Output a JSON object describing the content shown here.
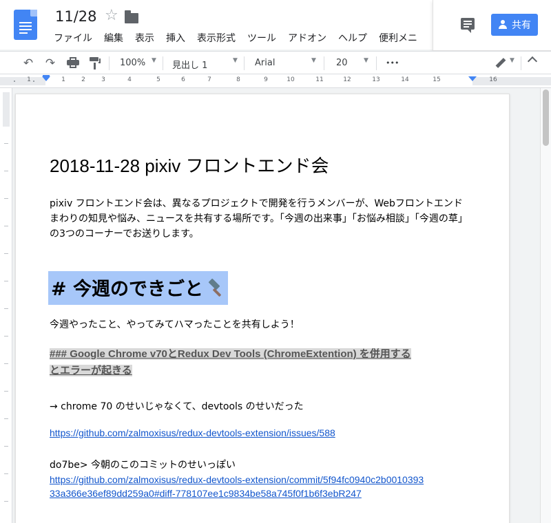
{
  "header": {
    "doc_title": "11/28",
    "menus": [
      "ファイル",
      "編集",
      "表示",
      "挿入",
      "表示形式",
      "ツール",
      "アドオン",
      "ヘルプ",
      "便利メニ"
    ],
    "share_label": "共有",
    "brand_color": "#4285f4"
  },
  "toolbar": {
    "zoom": "100%",
    "style": "見出し 1",
    "font": "Arial",
    "size": "20",
    "more": "•••",
    "undo_icon": "↶",
    "redo_icon": "↷"
  },
  "ruler": {
    "ticks": [
      "1",
      "2",
      "3",
      "4",
      "5",
      "6",
      "7",
      "8",
      "9",
      "10",
      "11",
      "12",
      "13",
      "14",
      "15",
      "16"
    ]
  },
  "document": {
    "title": "2018-11-28 pixiv フロントエンド会",
    "intro": "pixiv フロントエンド会は、異なるプロジェクトで開発を行うメンバーが、Webフロントエンドまわりの知見や悩み、ニュースを共有する場所です。「今週の出来事」「お悩み相談」「今週の草」の3つのコーナーでお送りします。",
    "section_heading": "# 今週のできごと",
    "section_heading_highlight": "#a7c7f9",
    "section_intro": "今週やったこと、やってみてハマったことを共有しよう！",
    "subheading_line1": "### Google Chrome v70とRedux Dev Tools (ChromeExtention) を併用する",
    "subheading_line2": "とエラーが起きる",
    "arrow_note": "→ chrome 70 のせいじゃなくて、devtools のせいだった",
    "link_issue": "https://github.com/zalmoxisus/redux-devtools-extension/issues/588",
    "commit_note": "do7be> 今朝のこのコミットのせいっぽい",
    "link_commit_line1": "https://github.com/zalmoxisus/redux-devtools-extension/commit/5f94fc0940c2b0010393",
    "link_commit_line2": "33a366e36ef89dd259a0#diff-778107ee1c9834be58a745f0f1b6f3ebR247",
    "link_color": "#1155cc"
  }
}
